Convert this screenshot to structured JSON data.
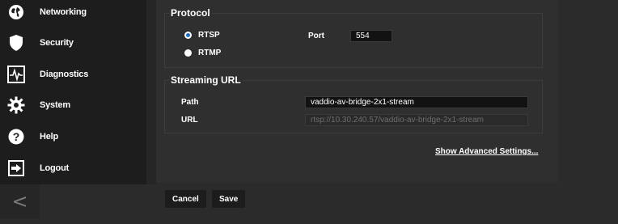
{
  "sidebar": {
    "items": [
      {
        "label": "Networking",
        "icon": "globe-icon"
      },
      {
        "label": "Security",
        "icon": "shield-icon"
      },
      {
        "label": "Diagnostics",
        "icon": "pulse-icon"
      },
      {
        "label": "System",
        "icon": "gear-icon"
      },
      {
        "label": "Help",
        "icon": "help-icon"
      },
      {
        "label": "Logout",
        "icon": "logout-icon"
      }
    ],
    "collapse_glyph": "<"
  },
  "protocol": {
    "title": "Protocol",
    "options": [
      {
        "label": "RTSP",
        "selected": true
      },
      {
        "label": "RTMP",
        "selected": false
      }
    ],
    "port_label": "Port",
    "port_value": "554"
  },
  "streaming_url": {
    "title": "Streaming URL",
    "path_label": "Path",
    "path_value": "vaddio-av-bridge-2x1-stream",
    "url_label": "URL",
    "url_value": "rtsp://10.30.240.57/vaddio-av-bridge-2x1-stream"
  },
  "advanced_link": "Show Advanced Settings...",
  "buttons": {
    "cancel": "Cancel",
    "save": "Save"
  },
  "colors": {
    "accent": "#1a6fc4",
    "sidebar_bg": "#1d1d1d",
    "panel_bg": "#2f2f2f"
  }
}
